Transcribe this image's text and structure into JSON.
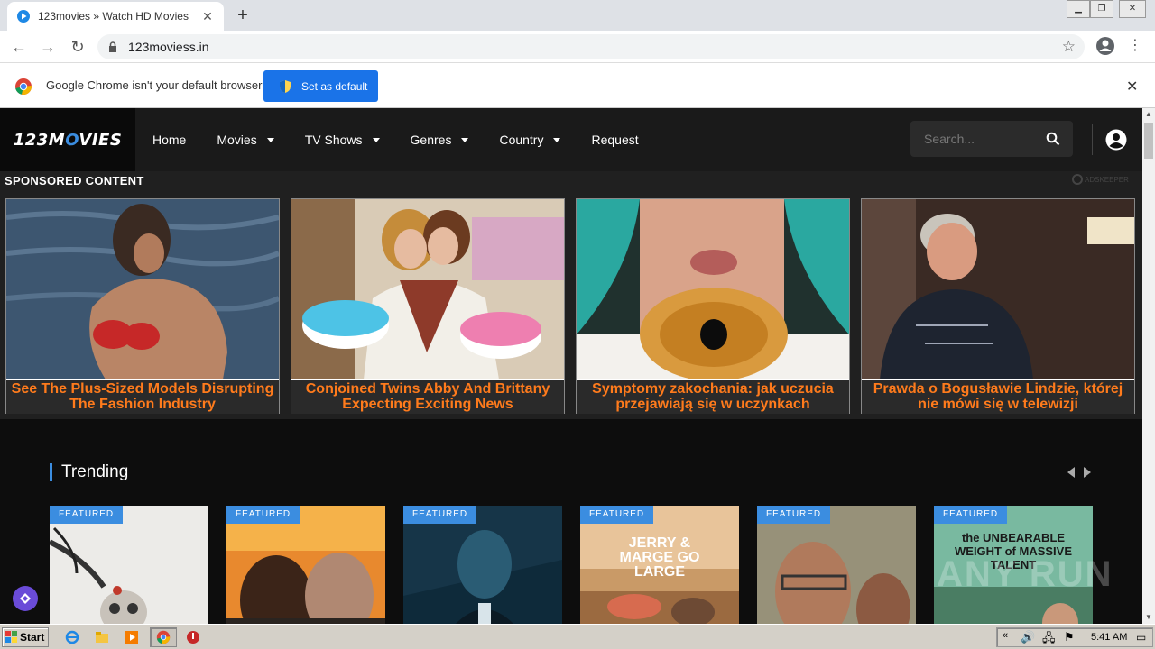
{
  "browser": {
    "tab_title": "123movies » Watch HD Movies & TV",
    "url": "123moviess.in",
    "infobar_text": "Google Chrome isn't your default browser",
    "set_default_label": "Set as default"
  },
  "site": {
    "logo_white_1": "123M",
    "logo_blue": "O",
    "logo_white_2": "VIES",
    "nav": [
      "Home",
      "Movies",
      "TV Shows",
      "Genres",
      "Country",
      "Request"
    ],
    "search_placeholder": "Search..."
  },
  "sponsored": {
    "title": "SPONSORED CONTENT",
    "brand": "ADSKEEPER",
    "ads": [
      {
        "caption": "See The Plus-Sized Models Disrupting The Fashion Industry"
      },
      {
        "caption": "Conjoined Twins Abby And Brittany Expecting Exciting News"
      },
      {
        "caption": "Symptomy zakochania: jak uczucia przejawiają się w uczynkach"
      },
      {
        "caption": "Prawda o Bogusławie Lindzie, której nie mówi się w telewizji"
      }
    ]
  },
  "trending": {
    "title": "Trending",
    "badge": "FEATURED",
    "poster_texts": [
      "",
      "",
      "",
      "JERRY & MARGE GO LARGE",
      "",
      "the UNBEARABLE WEIGHT of MASSIVE TALENT"
    ]
  },
  "watermark": "ANY RUN",
  "taskbar": {
    "start_label": "Start",
    "clock": "5:41 AM"
  },
  "colors": {
    "accent": "#3b8de0",
    "caption_orange": "#ff7b1c",
    "chrome_blue": "#1a73e8"
  }
}
